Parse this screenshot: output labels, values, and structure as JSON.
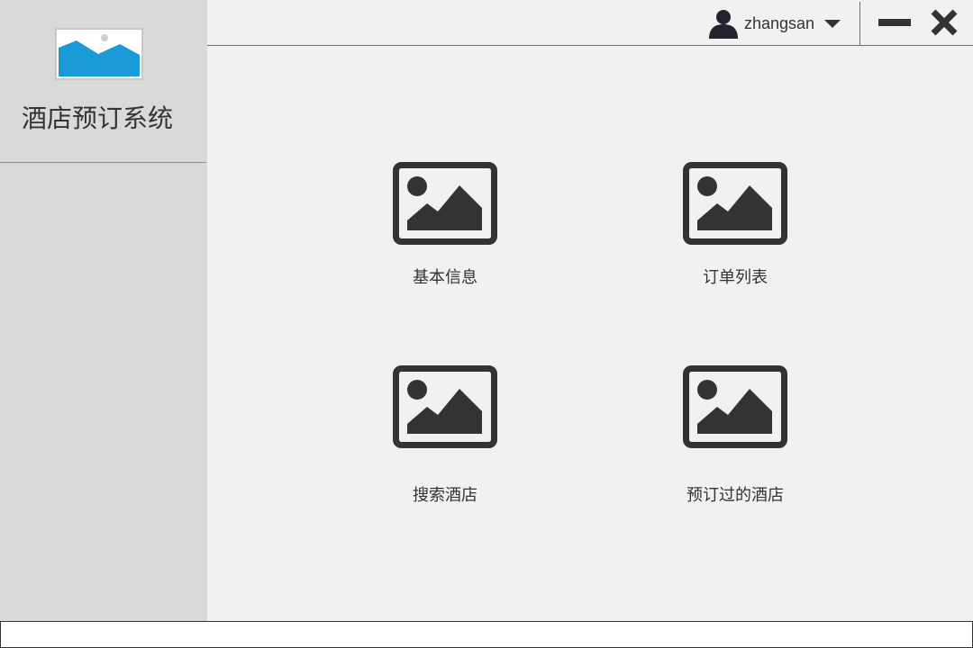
{
  "app": {
    "title": "酒店预订系统"
  },
  "topbar": {
    "username": "zhangsan"
  },
  "tiles": [
    {
      "label": "基本信息",
      "icon": "image-placeholder-icon"
    },
    {
      "label": "订单列表",
      "icon": "image-placeholder-icon"
    },
    {
      "label": "搜索酒店",
      "icon": "image-placeholder-icon"
    },
    {
      "label": "预订过的酒店",
      "icon": "image-placeholder-icon"
    }
  ],
  "colors": {
    "sidebar_bg": "#d9d9d9",
    "page_bg": "#f1f1f1",
    "icon_dark": "#333333",
    "logo_blue": "#1a9bd7"
  }
}
